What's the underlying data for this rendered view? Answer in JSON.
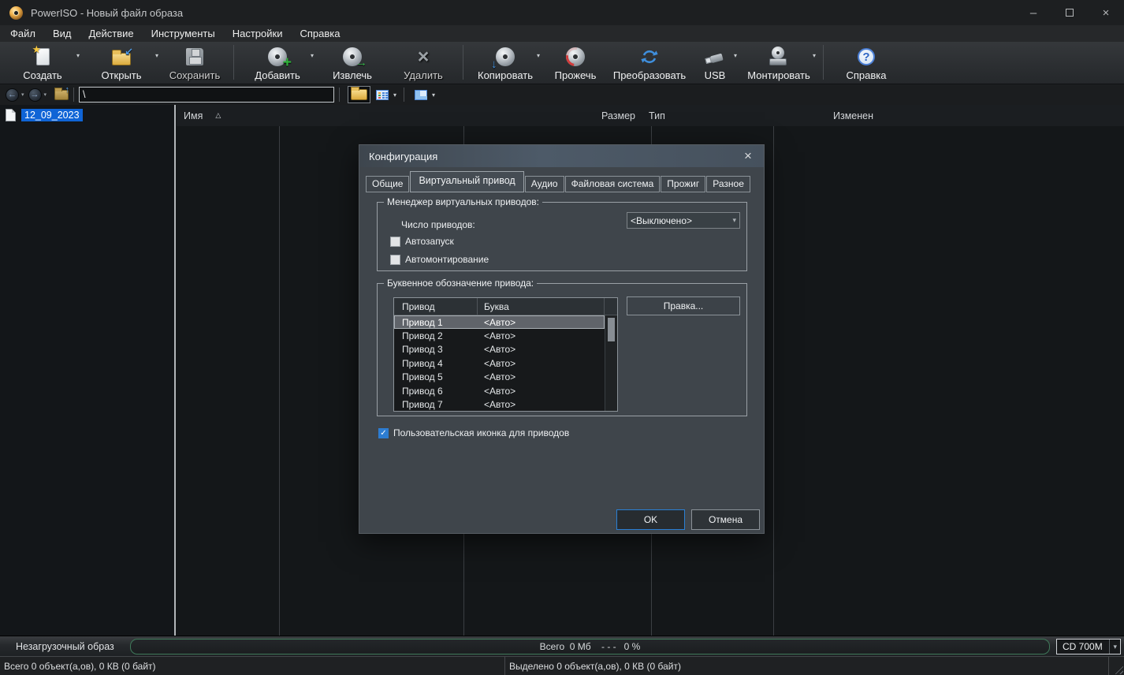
{
  "window": {
    "title": "PowerISO - Новый файл образа"
  },
  "icons": {
    "dropdown": "▾",
    "sort": "△",
    "check": "✓",
    "close": "×",
    "minimize": "–",
    "back": "←",
    "forward": "→",
    "up": "↑",
    "star": "★",
    "plus": "+",
    "arrow_right": "→",
    "arrow_down": "↓",
    "arrow_into": "↙",
    "question": "?",
    "delete_cross": "×"
  },
  "menu": {
    "items": [
      {
        "label": "Файл"
      },
      {
        "label": "Вид"
      },
      {
        "label": "Действие"
      },
      {
        "label": "Инструменты"
      },
      {
        "label": "Настройки"
      },
      {
        "label": "Справка"
      }
    ]
  },
  "toolbar": {
    "buttons": [
      {
        "label": "Создать"
      },
      {
        "label": "Открыть"
      },
      {
        "label": "Сохранить"
      },
      {
        "label": "Добавить"
      },
      {
        "label": "Извлечь"
      },
      {
        "label": "Удалить"
      },
      {
        "label": "Копировать"
      },
      {
        "label": "Прожечь"
      },
      {
        "label": "Преобразовать"
      },
      {
        "label": "USB"
      },
      {
        "label": "Монтировать"
      },
      {
        "label": "Справка"
      }
    ]
  },
  "address": {
    "path": "\\"
  },
  "columns": {
    "name": "Имя",
    "size": "Размер",
    "type": "Тип",
    "modified": "Изменен"
  },
  "tree": {
    "selected_item": "12_09_2023"
  },
  "dialog": {
    "title": "Конфигурация",
    "tabs": [
      {
        "label": "Общие"
      },
      {
        "label": "Виртуальный привод"
      },
      {
        "label": "Аудио"
      },
      {
        "label": "Файловая система"
      },
      {
        "label": "Прожиг"
      },
      {
        "label": "Разное"
      }
    ],
    "manager_group": {
      "title": "Менеджер виртуальных приводов:",
      "drive_count_label": "Число приводов:",
      "drive_count_value": "<Выключено>",
      "autorun_label": "Автозапуск",
      "automount_label": "Автомонтирование"
    },
    "letters_group": {
      "title": "Буквенное обозначение привода:",
      "col_drive": "Привод",
      "col_letter": "Буква",
      "edit_button": "Правка...",
      "rows": [
        {
          "drive": "Привод 1",
          "letter": "<Авто>"
        },
        {
          "drive": "Привод 2",
          "letter": "<Авто>"
        },
        {
          "drive": "Привод 3",
          "letter": "<Авто>"
        },
        {
          "drive": "Привод 4",
          "letter": "<Авто>"
        },
        {
          "drive": "Привод 5",
          "letter": "<Авто>"
        },
        {
          "drive": "Привод 6",
          "letter": "<Авто>"
        },
        {
          "drive": "Привод 7",
          "letter": "<Авто>"
        }
      ]
    },
    "custom_icon_checkbox": "Пользовательская иконка для приводов",
    "ok_button": "OK",
    "cancel_button": "Отмена"
  },
  "footer": {
    "boot_status": "Незагрузочный образ",
    "progress_text": "Всего  0 Мб    - - -   0 %",
    "media_type": "CD 700M",
    "status_left": "Всего 0 объект(а,ов), 0 КВ (0 байт)",
    "status_right": "Выделено 0 объект(а,ов), 0 КВ (0 байт)"
  },
  "colors": {
    "selection_blue": "#0f64d6",
    "accent_blue": "#2a7fd4",
    "checkbox_blue": "#2d7dd2",
    "progress_border_green": "#3f7a5a",
    "dialog_bg": "#3f454b",
    "content_bg": "#141719"
  }
}
